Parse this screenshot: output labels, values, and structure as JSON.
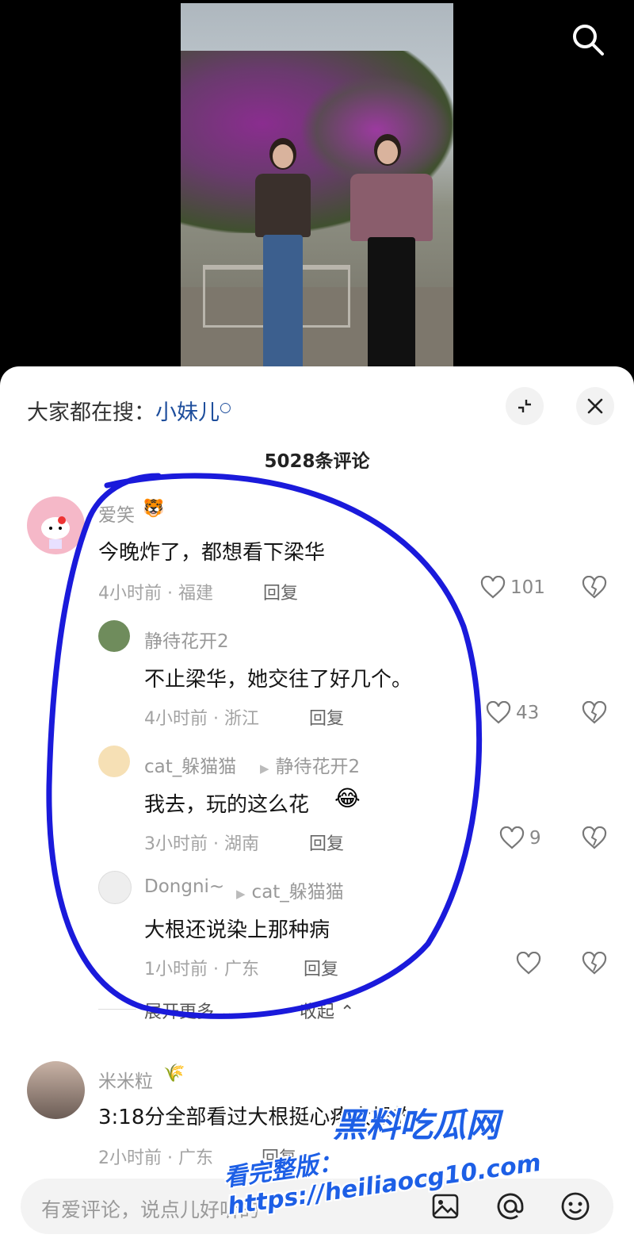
{
  "search_suggest": {
    "prefix": "大家都在搜：",
    "keyword": "小妹儿"
  },
  "comment_count": "5028条评论",
  "comments": [
    {
      "user": "爱笑",
      "text": "今晚炸了，都想看下梁华",
      "time_location": "4小时前 · 福建",
      "reply_label": "回复",
      "likes": "101",
      "replies": [
        {
          "user": "静待花开2",
          "reply_to": "",
          "text": "不止梁华，她交往了好几个。",
          "time_location": "4小时前 · 浙江",
          "reply_label": "回复",
          "likes": "43"
        },
        {
          "user": "cat_躲猫猫",
          "reply_to": "静待花开2",
          "text": "我去，玩的这么花",
          "time_location": "3小时前 · 湖南",
          "reply_label": "回复",
          "likes": "9"
        },
        {
          "user": "Dongni~",
          "reply_to": "cat_躲猫猫",
          "text": "大根还说染上那种病",
          "time_location": "1小时前 · 广东",
          "reply_label": "回复",
          "likes": ""
        }
      ],
      "expand_more": "展开更多",
      "collapse": "收起"
    },
    {
      "user": "米米粒",
      "text": "3:18分全部看过大根挺心疼大根的",
      "time_location": "2小时前 · 广东",
      "reply_label": "回复",
      "likes": ""
    }
  ],
  "input": {
    "placeholder": "有爱评论，说点儿好听的"
  },
  "watermark": {
    "site": "黑料吃瓜网",
    "url_line": "看完整版：https://heiliaocg10.com"
  },
  "icons": [
    "search-icon",
    "collapse-screen-icon",
    "close-icon",
    "heart-icon",
    "heart-broken-icon",
    "image-icon",
    "at-icon",
    "emoji-icon",
    "chevron-down-icon",
    "chevron-up-icon"
  ],
  "colors": {
    "keyword": "#1e4e9c",
    "annotation_circle": "#1a1adb",
    "watermark": "#1d5fe6"
  }
}
